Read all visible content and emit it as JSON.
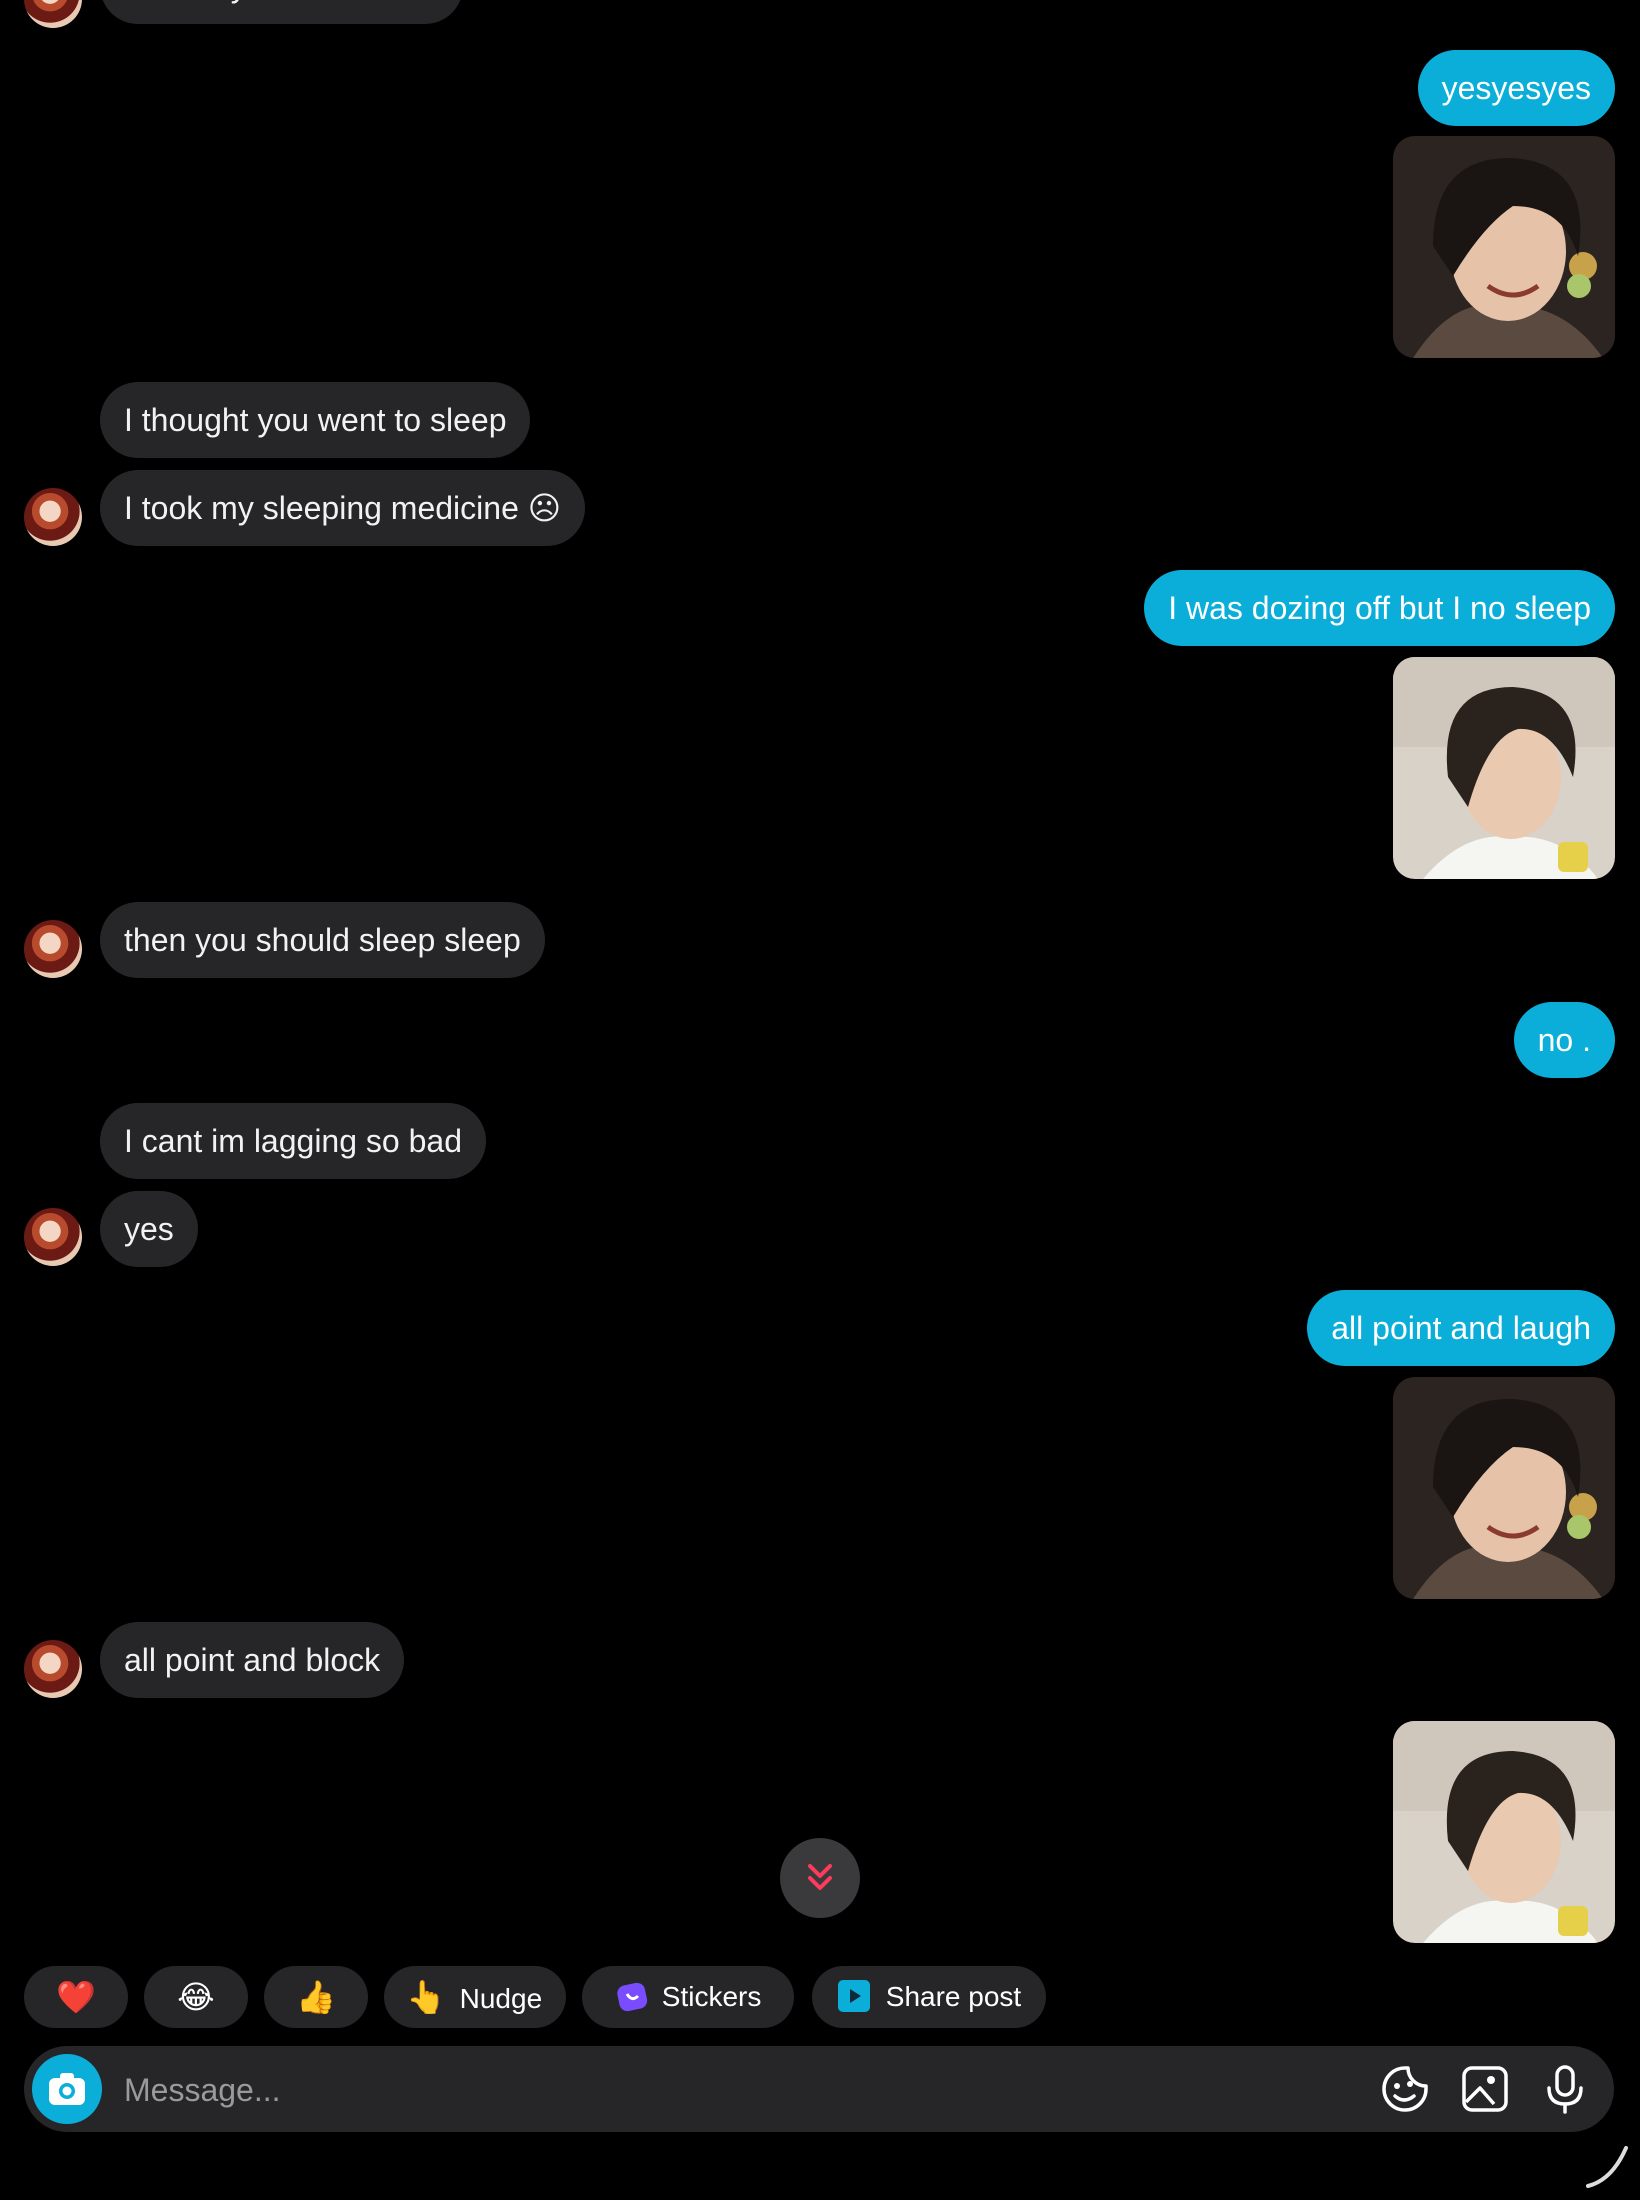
{
  "messages": {
    "top_partial": "Oh are you still awake",
    "m1": "yesyesyes",
    "m2": "I thought you went to sleep",
    "m3": "I took my sleeping medicine ☹",
    "m4": "I was dozing off but I no sleep",
    "m5": "then you should sleep sleep",
    "m6": "no .",
    "m7": "I cant im lagging so bad",
    "m8": "yes",
    "m9": "all point and laugh",
    "m10": "all point and block"
  },
  "quick_replies": {
    "heart": "❤️",
    "laugh": "😂",
    "thumbs": "👍",
    "nudge_emoji": "👆",
    "nudge": "Nudge",
    "stickers": "Stickers",
    "share_post": "Share post"
  },
  "composer": {
    "placeholder": "Message..."
  },
  "colors": {
    "outgoing": "#0aaed8",
    "incoming": "#262628",
    "background": "#000000"
  }
}
